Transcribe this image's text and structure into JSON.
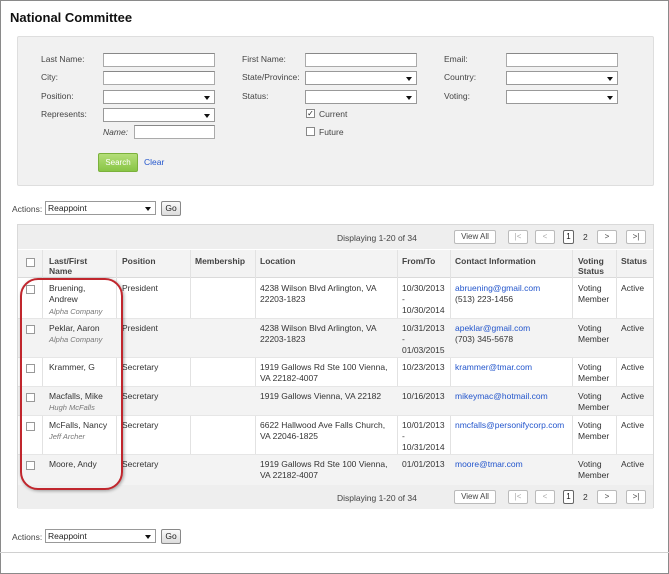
{
  "page": {
    "title": "National Committee"
  },
  "search": {
    "last_name_label": "Last Name:",
    "first_name_label": "First Name:",
    "email_label": "Email:",
    "city_label": "City:",
    "state_label": "State/Province:",
    "country_label": "Country:",
    "position_label": "Position:",
    "status_label": "Status:",
    "voting_label": "Voting:",
    "represents_label": "Represents:",
    "name_label": "Name:",
    "current_label": "Current",
    "current_checked": true,
    "future_label": "Future",
    "future_checked": false,
    "current_check_glyph": "✓",
    "search_button": "Search",
    "clear_link": "Clear"
  },
  "actions": {
    "label": "Actions:",
    "selected": "Reappoint",
    "go_button": "Go"
  },
  "pager": {
    "displaying": "Displaying 1-20 of 34",
    "view_all": "View All",
    "first": "|<",
    "prev": "<",
    "page1": "1",
    "page2": "2",
    "next": ">",
    "last": ">|"
  },
  "table": {
    "columns": [
      "Last/First Name",
      "Position",
      "Membership",
      "Location",
      "From/To",
      "Contact Information",
      "Voting Status",
      "Status"
    ],
    "rows": [
      {
        "name": "Bruening, Andrew",
        "name_l1": "Bruening,",
        "name_l2": "Andrew",
        "org": "Alpha Company",
        "position": "President",
        "membership": "",
        "loc1": "4238 Wilson Blvd Arlington, VA",
        "loc2": "22203-1823",
        "from": "10/30/2013",
        "dash": "-",
        "to": "10/30/2014",
        "email": "abruening@gmail.com",
        "phone": "(513) 223-1456",
        "voting1": "Voting",
        "voting2": "Member",
        "status": "Active"
      },
      {
        "name": "Peklar, Aaron",
        "org": "Alpha Company",
        "position": "President",
        "membership": "",
        "loc1": "4238 Wilson Blvd Arlington, VA",
        "loc2": "22203-1823",
        "from": "10/31/2013",
        "dash": "-",
        "to": "01/03/2015",
        "email": "apeklar@gmail.com",
        "phone": "(703) 345-5678",
        "voting1": "Voting",
        "voting2": "Member",
        "status": "Active"
      },
      {
        "name": "Krammer, G",
        "org": "",
        "position": "Secretary",
        "membership": "",
        "loc1": "1919 Gallows Rd Ste 100 Vienna,",
        "loc2": "VA 22182-4007",
        "from": "10/23/2013",
        "dash": "",
        "to": "",
        "email": "krammer@tmar.com",
        "phone": "",
        "voting1": "Voting",
        "voting2": "Member",
        "status": "Active"
      },
      {
        "name": "Macfalls, Mike",
        "org": "Hugh McFalls",
        "position": "Secretary",
        "membership": "",
        "loc1": "1919 Gallows Vienna, VA 22182",
        "loc2": "",
        "from": "10/16/2013",
        "dash": "",
        "to": "",
        "email": "mikeymac@hotmail.com",
        "phone": "",
        "voting1": "Voting",
        "voting2": "Member",
        "status": "Active"
      },
      {
        "name": "McFalls, Nancy",
        "org": "Jeff Archer",
        "position": "Secretary",
        "membership": "",
        "loc1": "6622 Hallwood Ave Falls Church,",
        "loc2": "VA 22046-1825",
        "from": "10/01/2013",
        "dash": "-",
        "to": "10/31/2014",
        "email": "nmcfalls@personifycorp.com",
        "phone": "",
        "voting1": "Voting",
        "voting2": "Member",
        "status": "Active"
      },
      {
        "name": "Moore, Andy",
        "org": "",
        "position": "Secretary",
        "membership": "",
        "loc1": "1919 Gallows Rd Ste 100 Vienna,",
        "loc2": "VA 22182-4007",
        "from": "01/01/2013",
        "dash": "",
        "to": "",
        "email": "moore@tmar.com",
        "phone": "",
        "voting1": "Voting",
        "voting2": "Member",
        "status": "Active"
      }
    ]
  },
  "colors": {
    "accent_link": "#2255cc",
    "search_button": "#88c545",
    "highlight": "#c0262d"
  }
}
